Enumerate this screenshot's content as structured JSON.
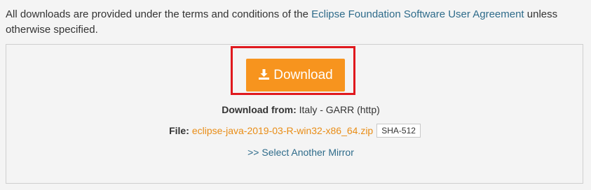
{
  "notice": {
    "prefix": "All downloads are provided under the terms and conditions of the ",
    "link_text": "Eclipse Foundation Software User Agreement",
    "suffix": " unless otherwise specified."
  },
  "download": {
    "button_label": "Download",
    "button_color": "#f7941e",
    "highlight_color": "#e0191e",
    "icon": "download-icon",
    "from_label": "Download from:",
    "from_value": " Italy - GARR (http)",
    "file_label": "File:",
    "file_name": "eclipse-java-2019-03-R-win32-x86_64.zip",
    "checksum_label": "SHA-512",
    "mirror_link": ">> Select Another Mirror"
  }
}
